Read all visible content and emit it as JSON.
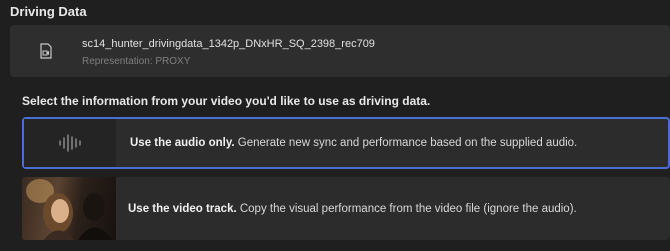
{
  "section_title": "Driving Data",
  "file": {
    "name": "sc14_hunter_drivingdata_1342p_DNxHR_SQ_2398_rec709",
    "representation": "Representation: PROXY",
    "icon": "video-file-icon"
  },
  "instruction": "Select the information from your video you'd like to use as driving data.",
  "options": [
    {
      "title": "Use the audio only.",
      "description": "Generate new sync and performance based on the supplied audio.",
      "icon": "audio-waveform-icon",
      "selected": true
    },
    {
      "title": "Use the video track.",
      "description": "Copy the visual performance from the video file (ignore the audio).",
      "icon": "video-thumbnail",
      "selected": false
    }
  ],
  "colors": {
    "background": "#1f1f1f",
    "card": "#2e2e2e",
    "selected_border": "#4a6fd3"
  }
}
